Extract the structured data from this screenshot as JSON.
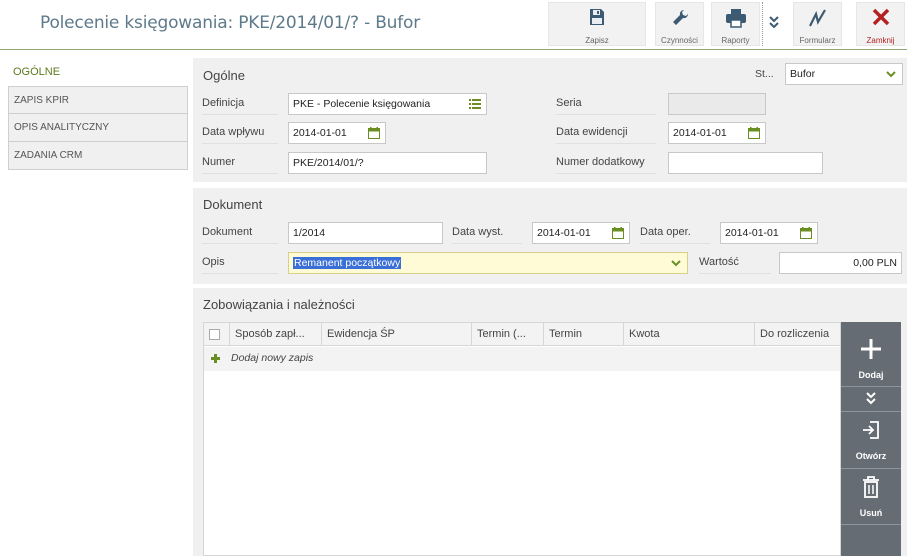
{
  "window": {
    "title": "Polecenie księgowania: PKE/2014/01/? - Bufor"
  },
  "toolbar": {
    "save": "Zapisz",
    "actions": "Czynności",
    "reports": "Raporty",
    "form": "Formularz",
    "close": "Zamknij"
  },
  "sidebar": {
    "items": [
      {
        "label": "OGÓLNE"
      },
      {
        "label": "ZAPIS KPIR"
      },
      {
        "label": "OPIS ANALITYCZNY"
      },
      {
        "label": "ZADANIA CRM"
      }
    ]
  },
  "general": {
    "title": "Ogólne",
    "status_label": "St...",
    "status_value": "Bufor",
    "definition_label": "Definicja",
    "definition_value": "PKE - Polecenie księgowania",
    "series_label": "Seria",
    "series_value": "",
    "receipt_date_label": "Data wpływu",
    "receipt_date_value": "2014-01-01",
    "record_date_label": "Data ewidencji",
    "record_date_value": "2014-01-01",
    "number_label": "Numer",
    "number_value": "PKE/2014/01/?",
    "extra_number_label": "Numer dodatkowy",
    "extra_number_value": ""
  },
  "document": {
    "title": "Dokument",
    "doc_label": "Dokument",
    "doc_value": "1/2014",
    "issue_date_label": "Data wyst.",
    "issue_date_value": "2014-01-01",
    "oper_date_label": "Data oper.",
    "oper_date_value": "2014-01-01",
    "desc_label": "Opis",
    "desc_value": "Remanent początkowy",
    "value_label": "Wartość",
    "value_value": "0,00 PLN"
  },
  "liabilities": {
    "title": "Zobowiązania i należności",
    "columns": [
      "Sposób zapł...",
      "Ewidencja ŚP",
      "Termin (...",
      "Termin",
      "Kwota",
      "Do rozliczenia"
    ],
    "add_row": "Dodaj nowy zapis"
  },
  "actions": {
    "add": "Dodaj",
    "open": "Otwórz",
    "delete": "Usuń"
  },
  "colors": {
    "accent_green": "#5c7a1c",
    "close_red": "#b22222",
    "action_bar": "#656c73",
    "title_blue": "#5d7a8a"
  }
}
